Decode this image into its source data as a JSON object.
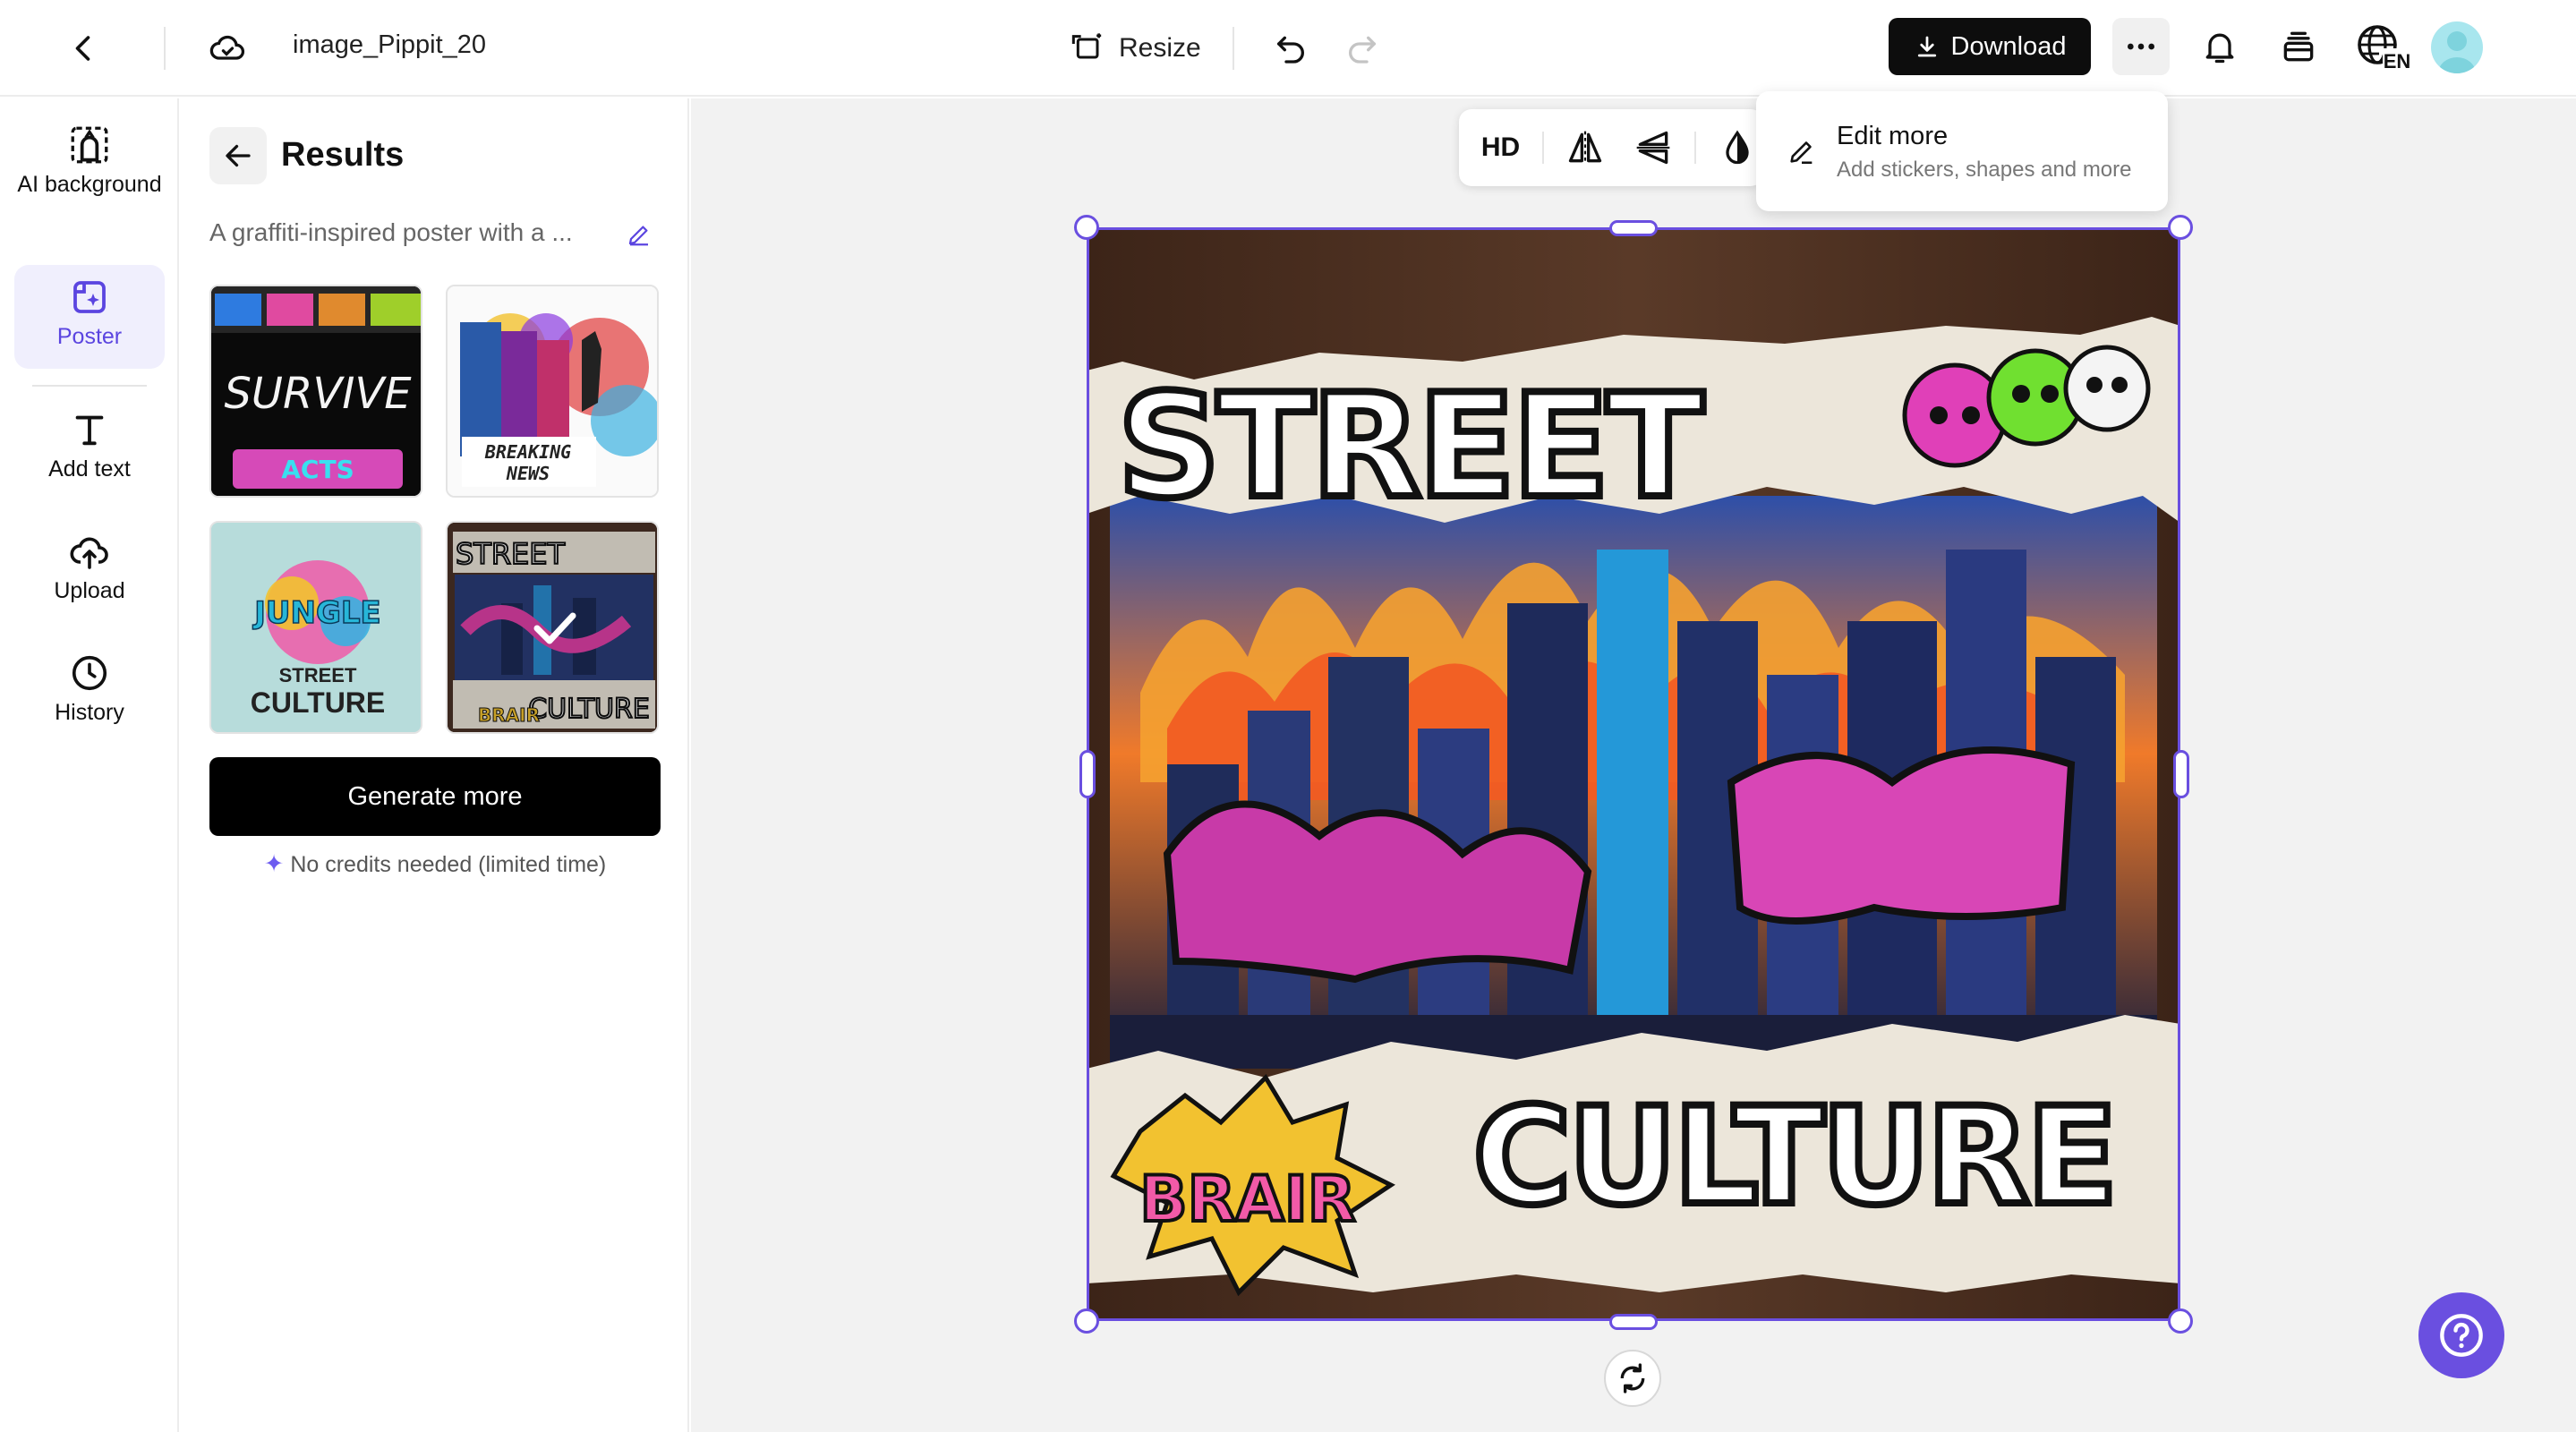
{
  "header": {
    "filename": "image_Pippit_20",
    "resize_label": "Resize",
    "download_label": "Download",
    "lang_code": "EN"
  },
  "leftnav": {
    "items": [
      {
        "label": "AI background",
        "icon": "ai-background-icon"
      },
      {
        "label": "Poster",
        "icon": "poster-icon",
        "active": true
      },
      {
        "label": "Add text",
        "icon": "text-icon"
      },
      {
        "label": "Upload",
        "icon": "upload-icon"
      },
      {
        "label": "History",
        "icon": "history-icon"
      }
    ]
  },
  "panel": {
    "title": "Results",
    "prompt": "A graffiti-inspired poster with a ...",
    "thumbnails": [
      {
        "name": "result-survive"
      },
      {
        "name": "result-breaking-news"
      },
      {
        "name": "result-street-culture-light"
      },
      {
        "name": "result-street-culture-selected",
        "selected": true
      }
    ],
    "generate_label": "Generate more",
    "credits_note": "No credits needed (limited time)"
  },
  "toolbar": {
    "hd_label": "HD"
  },
  "popup": {
    "title": "Edit more",
    "subtitle": "Add stickers, shapes and more"
  },
  "colors": {
    "accent": "#6a4fe0",
    "primary_button": "#0d0d0d",
    "active_nav_bg": "#f0effd"
  }
}
